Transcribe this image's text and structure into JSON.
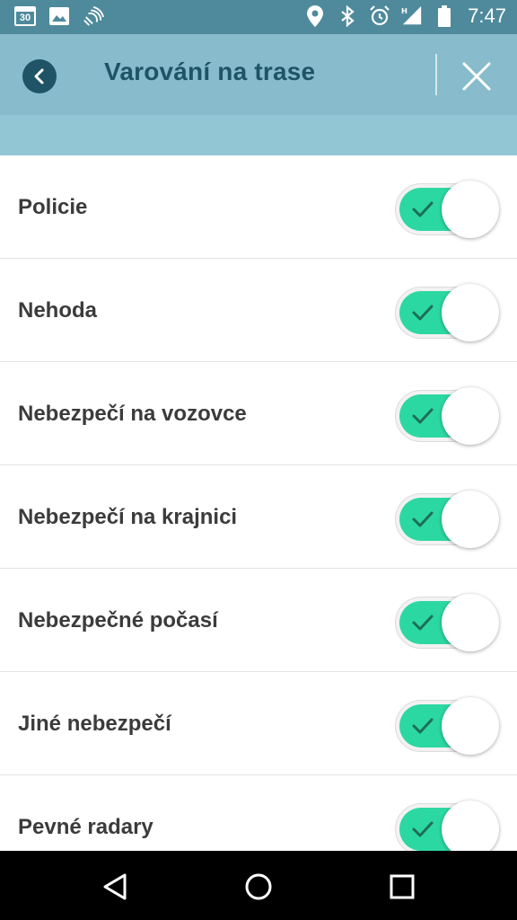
{
  "status_bar": {
    "calendar_day": "30",
    "time": "7:47",
    "icons": [
      "calendar-icon",
      "image-icon",
      "cast-icon",
      "location-icon",
      "bluetooth-icon",
      "alarm-icon",
      "signal-icon",
      "battery-icon"
    ]
  },
  "header": {
    "title": "Varování na trase",
    "back_icon": "chevron-left-icon",
    "close_icon": "close-icon"
  },
  "colors": {
    "status_bar": "#4e8a9b",
    "header": "#88bccc",
    "title": "#1e5466",
    "toggle_on": "#2cd8a2"
  },
  "settings": [
    {
      "label": "Policie",
      "enabled": true
    },
    {
      "label": "Nehoda",
      "enabled": true
    },
    {
      "label": "Nebezpečí na vozovce",
      "enabled": true
    },
    {
      "label": "Nebezpečí na krajnici",
      "enabled": true
    },
    {
      "label": "Nebezpečné počasí",
      "enabled": true
    },
    {
      "label": "Jiné nebezpečí",
      "enabled": true
    },
    {
      "label": "Pevné radary",
      "enabled": true
    }
  ]
}
